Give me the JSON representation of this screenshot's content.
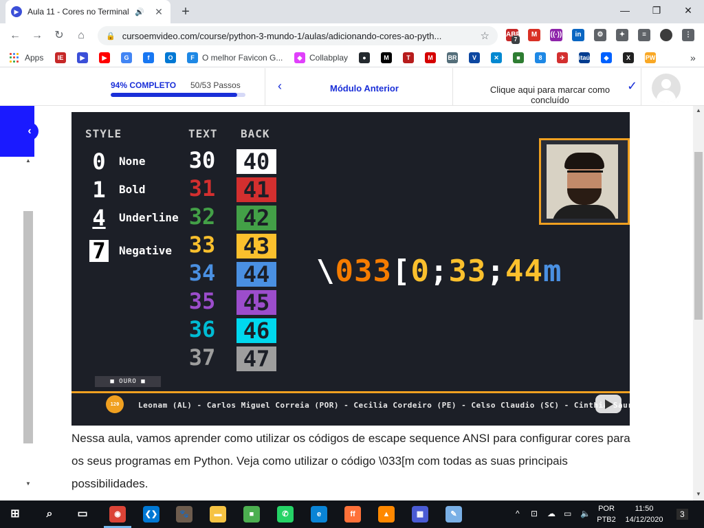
{
  "browser": {
    "tab": {
      "title": "Aula 11 - Cores no Terminal",
      "favicon": "cev-icon",
      "audio": "speaker-icon"
    },
    "new_tab_symbol": "+",
    "window": {
      "minimize": "—",
      "restore": "❐",
      "close": "✕"
    },
    "toolbar": {
      "url": "cursoemvideo.com/course/python-3-mundo-1/aulas/adicionando-cores-ao-pyth...",
      "extensions": [
        {
          "name": "adblock-icon",
          "label": "ABP",
          "badge": "7",
          "color": "#c62828"
        },
        {
          "name": "gmail-icon",
          "label": "M",
          "color": "#d93025"
        },
        {
          "name": "podcast-icon",
          "label": "((·))",
          "color": "#8e24aa"
        },
        {
          "name": "linkedin-icon",
          "label": "in",
          "color": "#0a66c2"
        },
        {
          "name": "settings-gear-icon",
          "label": "⚙",
          "color": "#5f6368"
        },
        {
          "name": "extensions-puzzle-icon",
          "label": "✦",
          "color": "#5f6368"
        },
        {
          "name": "media-queue-icon",
          "label": "≡",
          "color": "#5f6368"
        },
        {
          "name": "profile-avatar-icon",
          "label": "",
          "color": "#3c3c3c"
        },
        {
          "name": "kebab-menu-icon",
          "label": "⋮",
          "color": "#5f6368"
        }
      ]
    },
    "bookmarks": [
      {
        "name": "apps",
        "label": "Apps"
      },
      {
        "name": "iesb",
        "label": "",
        "icon": "IE",
        "color": "#c62828"
      },
      {
        "name": "cev",
        "label": "",
        "icon": "▶",
        "color": "#3b4fd8"
      },
      {
        "name": "youtube",
        "label": "",
        "icon": "▶",
        "color": "#ff0000"
      },
      {
        "name": "google",
        "label": "",
        "icon": "G",
        "color": "#4285f4"
      },
      {
        "name": "facebook",
        "label": "",
        "icon": "f",
        "color": "#1877f2"
      },
      {
        "name": "outlook",
        "label": "",
        "icon": "O",
        "color": "#0078d4"
      },
      {
        "name": "favicon-generator",
        "label": "O melhor Favicon G...",
        "icon": "F",
        "color": "#1e88e5"
      },
      {
        "name": "collabplay",
        "label": "Collabplay",
        "icon": "◆",
        "color": "#e040fb"
      },
      {
        "name": "github",
        "label": "",
        "icon": "●",
        "color": "#24292e"
      },
      {
        "name": "medium",
        "label": "",
        "icon": "M",
        "color": "#000000"
      },
      {
        "name": "tam",
        "label": "",
        "icon": "T",
        "color": "#b71c1c"
      },
      {
        "name": "mega",
        "label": "",
        "icon": "M",
        "color": "#d50000"
      },
      {
        "name": "br",
        "label": "",
        "icon": "BR",
        "color": "#546e7a"
      },
      {
        "name": "vto",
        "label": "",
        "icon": "V",
        "color": "#0d47a1"
      },
      {
        "name": "x-app",
        "label": "",
        "icon": "✕",
        "color": "#0288d1"
      },
      {
        "name": "flag",
        "label": "",
        "icon": "■",
        "color": "#2e7d32"
      },
      {
        "name": "eight",
        "label": "",
        "icon": "8",
        "color": "#1e88e5"
      },
      {
        "name": "plane",
        "label": "",
        "icon": "✈",
        "color": "#d32f2f"
      },
      {
        "name": "itau",
        "label": "",
        "icon": "itaú",
        "color": "#003c8f"
      },
      {
        "name": "dropbox",
        "label": "",
        "icon": "◆",
        "color": "#0061ff"
      },
      {
        "name": "xtool",
        "label": "",
        "icon": "X",
        "color": "#212121"
      },
      {
        "name": "pw",
        "label": "",
        "icon": "PW",
        "color": "#f9a825"
      }
    ],
    "bookmarks_overflow": "»"
  },
  "course_bar": {
    "progress_label": "94% COMPLETO",
    "progress_fraction": 0.94,
    "steps": "50/53 Passos",
    "prev_module": "Módulo Anterior",
    "mark_complete": "Clique aqui para marcar como concluído",
    "prev_chevron": "‹",
    "check": "✓",
    "side_chevron": "‹"
  },
  "video": {
    "headers": {
      "style": "STYLE",
      "text": "TEXT",
      "back": "BACK"
    },
    "styles": [
      {
        "num": "0",
        "name": "None"
      },
      {
        "num": "1",
        "name": "Bold"
      },
      {
        "num": "4",
        "name": "Underline"
      },
      {
        "num": "7",
        "name": "Negative"
      }
    ],
    "text_codes": [
      {
        "code": "30",
        "color": "#ffffff"
      },
      {
        "code": "31",
        "color": "#d32f2f"
      },
      {
        "code": "32",
        "color": "#43a047"
      },
      {
        "code": "33",
        "color": "#fbc02d"
      },
      {
        "code": "34",
        "color": "#4a90e2"
      },
      {
        "code": "35",
        "color": "#9c4dcc"
      },
      {
        "code": "36",
        "color": "#00bcd4"
      },
      {
        "code": "37",
        "color": "#9e9e9e"
      }
    ],
    "back_codes": [
      {
        "code": "40",
        "bg": "#ffffff",
        "fg": "#1c1f27"
      },
      {
        "code": "41",
        "bg": "#d32f2f",
        "fg": "#1c1f27"
      },
      {
        "code": "42",
        "bg": "#43a047",
        "fg": "#1c1f27"
      },
      {
        "code": "43",
        "bg": "#fbc02d",
        "fg": "#1c1f27"
      },
      {
        "code": "44",
        "bg": "#4a90e2",
        "fg": "#1c1f27"
      },
      {
        "code": "45",
        "bg": "#9c4dcc",
        "fg": "#1c1f27"
      },
      {
        "code": "46",
        "bg": "#00d8ee",
        "fg": "#1c1f27"
      },
      {
        "code": "47",
        "bg": "#9e9e9e",
        "fg": "#1c1f27"
      }
    ],
    "escape_parts": [
      {
        "t": "\\",
        "c": "#ffffff"
      },
      {
        "t": "033",
        "c": "#f57c00"
      },
      {
        "t": "[",
        "c": "#ffffff"
      },
      {
        "t": "0",
        "c": "#fbc02d"
      },
      {
        "t": ";",
        "c": "#ffffff"
      },
      {
        "t": "33",
        "c": "#fbc02d"
      },
      {
        "t": ";",
        "c": "#ffffff"
      },
      {
        "t": "44",
        "c": "#fbc02d"
      },
      {
        "t": "m",
        "c": "#4a90e2"
      }
    ],
    "badge": "■ OURO ■",
    "medal": "120",
    "ticker": "Leonam (AL) - Carlos Miguel Correia (POR) - Cecilia Cordeiro (PE) - Celso Claudio (SC) - Cinthia Saur"
  },
  "description": "Nessa aula, vamos aprender como utilizar os códigos de escape sequence ANSI para configurar cores para os seus programas em Python. Veja como utilizar o código \\033[m com todas as suas principais possibilidades.",
  "taskbar": {
    "apps": [
      {
        "name": "windows-start-icon",
        "label": "⊞",
        "color": "transparent"
      },
      {
        "name": "search-icon",
        "label": "⌕",
        "color": "transparent"
      },
      {
        "name": "task-view-icon",
        "label": "▭",
        "color": "transparent"
      },
      {
        "name": "chrome-icon",
        "label": "◉",
        "color": "#db4437"
      },
      {
        "name": "vscode-icon",
        "label": "❮❯",
        "color": "#0078d4"
      },
      {
        "name": "gimp-icon",
        "label": "🐾",
        "color": "#6d5c4e"
      },
      {
        "name": "file-explorer-icon",
        "label": "▬",
        "color": "#f6c343"
      },
      {
        "name": "cube-app-icon",
        "label": "■",
        "color": "#4caf50"
      },
      {
        "name": "whatsapp-icon",
        "label": "✆",
        "color": "#25d366"
      },
      {
        "name": "edge-icon",
        "label": "e",
        "color": "#0a84d6"
      },
      {
        "name": "firefox-icon",
        "label": "ff",
        "color": "#ff7139"
      },
      {
        "name": "vlc-icon",
        "label": "▲",
        "color": "#ff8800"
      },
      {
        "name": "calculator-icon",
        "label": "▦",
        "color": "#4a5bd4"
      },
      {
        "name": "paint-icon",
        "label": "✎",
        "color": "#7ab0e6"
      }
    ],
    "tray": {
      "chevron": "^",
      "lang_top": "POR",
      "lang_bottom": "PTB2",
      "time": "11:50",
      "date": "14/12/2020",
      "notifications": "3"
    }
  }
}
